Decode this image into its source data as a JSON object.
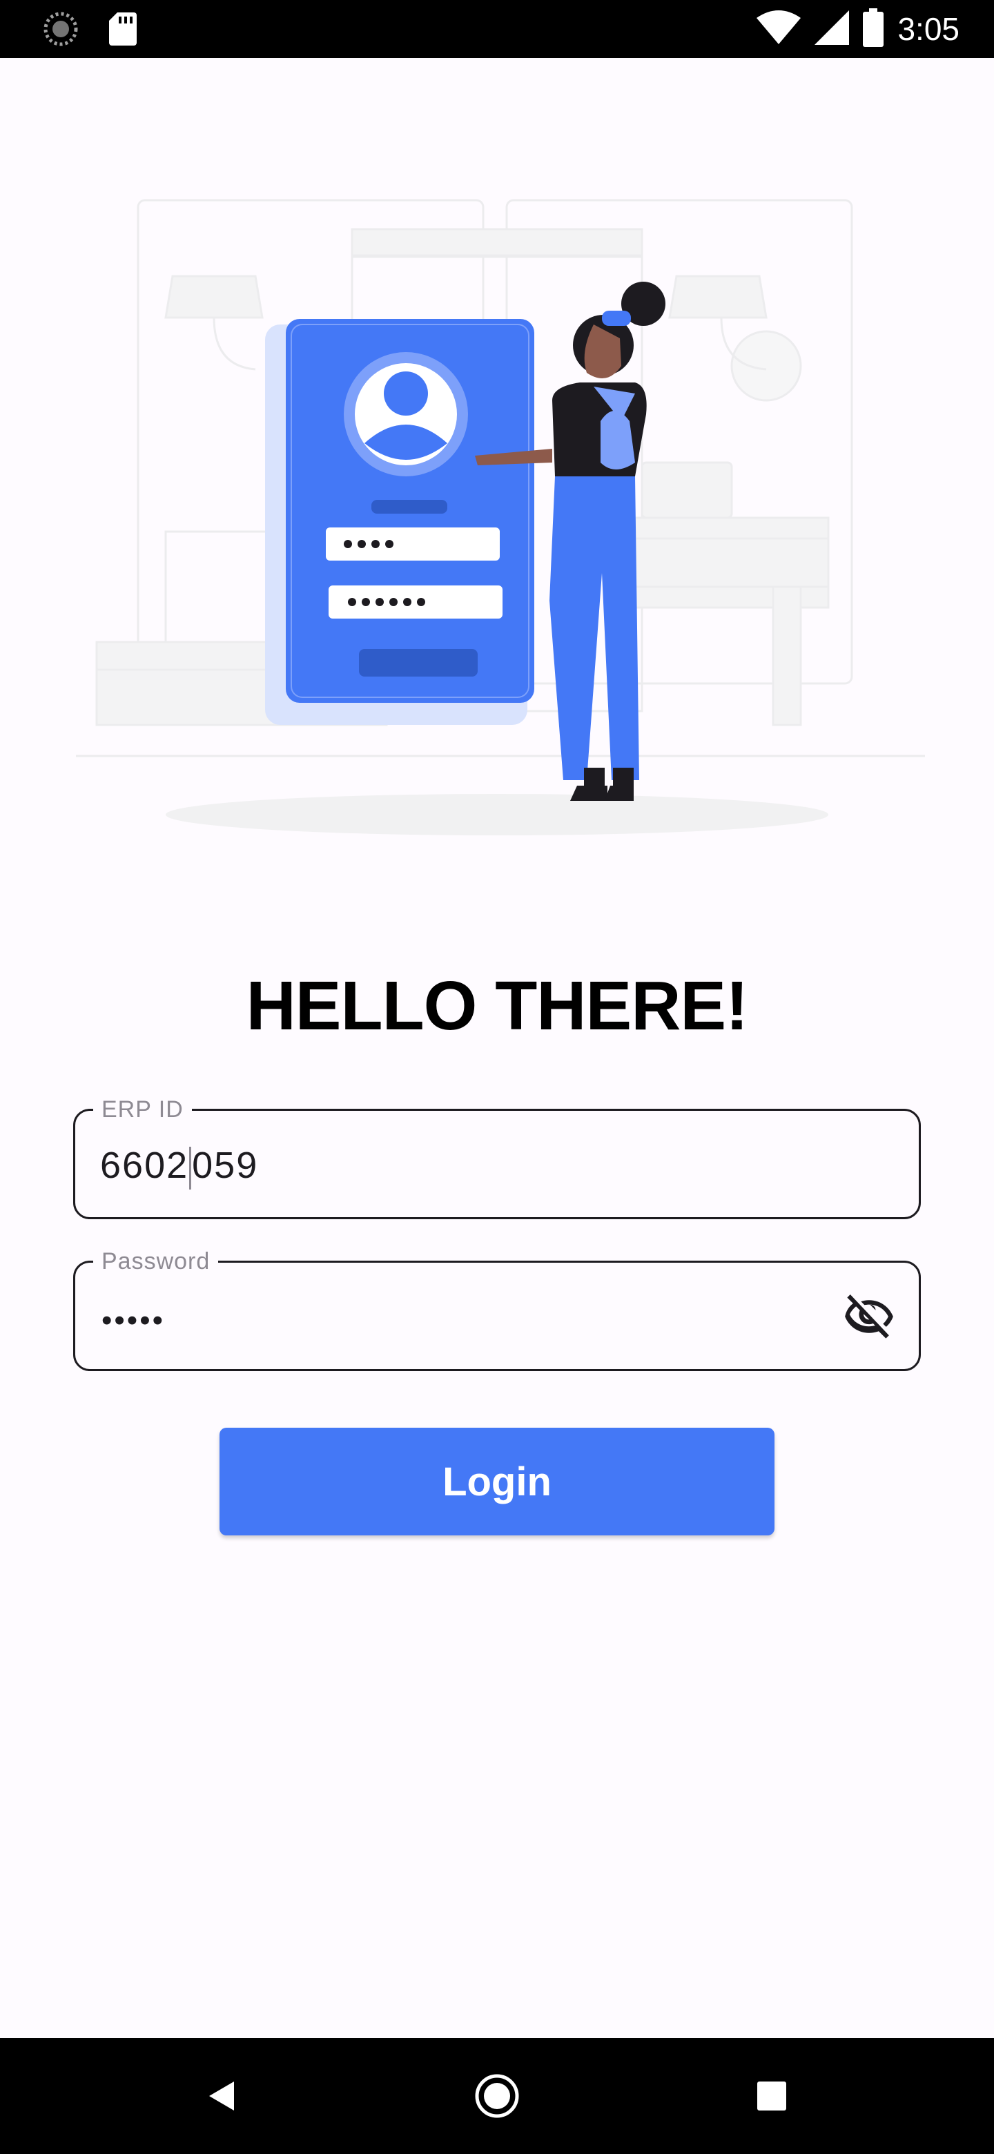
{
  "status_bar": {
    "time": "3:05",
    "icons": [
      "loading-spinner-icon",
      "sd-card-icon",
      "wifi-icon",
      "signal-icon",
      "battery-icon"
    ]
  },
  "illustration": {
    "subject": "login-illustration",
    "phone_pin_dots": "••••",
    "phone_password_dots": "••••••"
  },
  "heading": "HELLO THERE!",
  "form": {
    "erp": {
      "label": "ERP ID",
      "value_before_caret": "6602",
      "value_after_caret": "059"
    },
    "password": {
      "label": "Password",
      "masked_value": "•••••",
      "toggle_icon": "visibility-off-icon"
    }
  },
  "login_button": "Login",
  "colors": {
    "accent": "#4478f6",
    "background": "#fefbff",
    "text": "#000000",
    "label": "#8e8a93"
  },
  "nav_bar": {
    "icons": [
      "back-icon",
      "home-icon",
      "recents-icon"
    ]
  }
}
